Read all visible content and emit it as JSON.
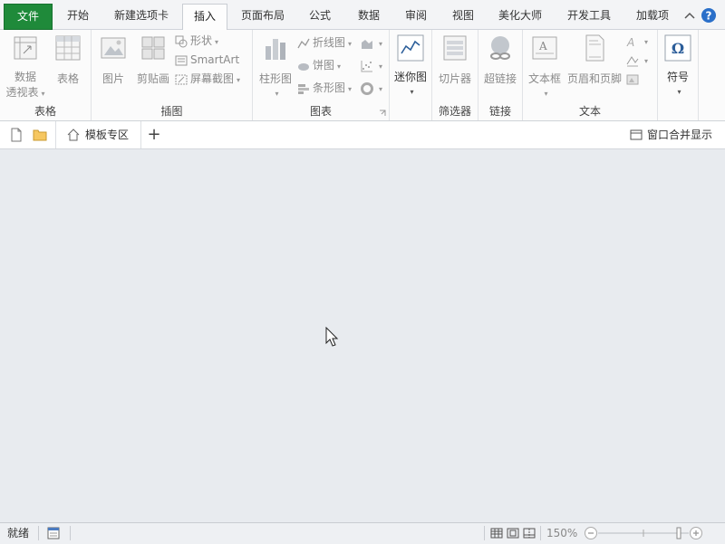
{
  "tabs": [
    {
      "label": "文件"
    },
    {
      "label": "开始"
    },
    {
      "label": "新建选项卡"
    },
    {
      "label": "插入"
    },
    {
      "label": "页面布局"
    },
    {
      "label": "公式"
    },
    {
      "label": "数据"
    },
    {
      "label": "审阅"
    },
    {
      "label": "视图"
    },
    {
      "label": "美化大师"
    },
    {
      "label": "开发工具"
    },
    {
      "label": "加载项"
    }
  ],
  "ribbon": {
    "groups": {
      "table": "表格",
      "illustration": "插图",
      "chart": "图表",
      "filter": "筛选器",
      "link": "链接",
      "text": "文本"
    },
    "pivot_line1": "数据",
    "pivot_line2": "透视表",
    "table_btn": "表格",
    "picture": "图片",
    "clipart": "剪贴画",
    "shapes": "形状",
    "smartart": "SmartArt",
    "screenshot": "屏幕截图",
    "column_chart": "柱形图",
    "line_chart": "折线图",
    "pie_chart": "饼图",
    "bar_chart": "条形图",
    "sparkline": "迷你图",
    "slicer": "切片器",
    "hyperlink": "超链接",
    "textbox": "文本框",
    "header_footer": "页眉和页脚",
    "symbol": "符号"
  },
  "toolbar": {
    "template_zone": "模板专区",
    "merge_windows": "窗口合并显示"
  },
  "status": {
    "ready": "就绪",
    "zoom": "150%"
  }
}
